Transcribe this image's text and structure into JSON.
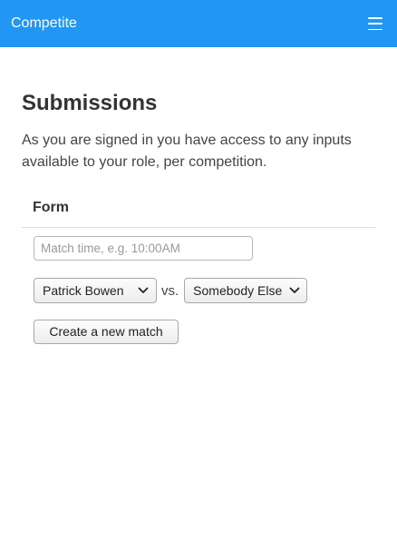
{
  "navbar": {
    "brand": "Competite",
    "menu_icon": "hamburger-menu-icon",
    "color": "#2196f3"
  },
  "main": {
    "title": "Submissions",
    "intro": "As you are signed in you have access to any inputs available to your role, per competition."
  },
  "form": {
    "header": "Form",
    "match_time": {
      "value": "",
      "placeholder": "Match time, e.g. 10:00AM"
    },
    "player_one": "Patrick Bowen",
    "vs_label": "vs.",
    "player_two": "Somebody Else",
    "submit_label": "Create a new match"
  }
}
